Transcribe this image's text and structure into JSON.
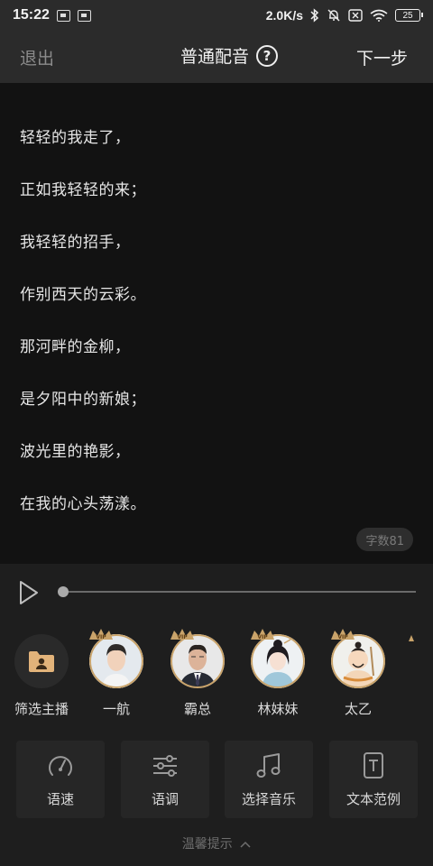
{
  "status_bar": {
    "time": "15:22",
    "net_speed": "2.0K/s",
    "battery": "25"
  },
  "header": {
    "exit_label": "退出",
    "title": "普通配音",
    "next_label": "下一步"
  },
  "poem": {
    "lines": [
      "轻轻的我走了，",
      "正如我轻轻的来；",
      "我轻轻的招手，",
      "作别西天的云彩。",
      "那河畔的金柳，",
      "是夕阳中的新娘；",
      "波光里的艳影，",
      "在我的心头荡漾。"
    ],
    "word_count": "字数81"
  },
  "player": {
    "progress": 0
  },
  "anchors": {
    "filter_label": "筛选主播",
    "vip_text": "VIP",
    "items": [
      {
        "name": "一航",
        "vip": true
      },
      {
        "name": "霸总",
        "vip": true
      },
      {
        "name": "林妹妹",
        "vip": true
      },
      {
        "name": "太乙",
        "vip": true
      }
    ]
  },
  "functions": [
    {
      "label": "语速",
      "icon": "speedometer-icon"
    },
    {
      "label": "语调",
      "icon": "sliders-icon"
    },
    {
      "label": "选择音乐",
      "icon": "music-note-icon"
    },
    {
      "label": "文本范例",
      "icon": "text-document-icon"
    }
  ],
  "tips": {
    "label": "温馨提示"
  },
  "colors": {
    "background": "#121212",
    "panel": "#1e1e1e",
    "card": "#262626",
    "vip_gold": "#c9a36a"
  }
}
